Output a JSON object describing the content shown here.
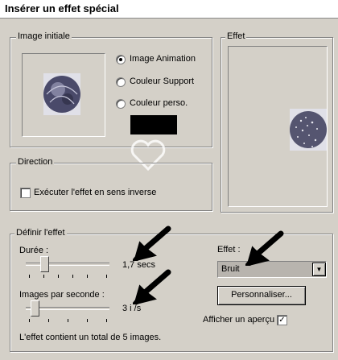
{
  "window": {
    "title": "Insérer un effet spécial"
  },
  "image_initiale": {
    "legend": "Image initiale",
    "options": [
      "Image Animation",
      "Couleur Support",
      "Couleur perso."
    ],
    "selected_index": 0,
    "color_swatch": "#000000"
  },
  "effet_preview": {
    "legend": "Effet"
  },
  "direction": {
    "legend": "Direction",
    "checkbox_label": "Exécuter l'effet en sens inverse",
    "checked": false
  },
  "definir": {
    "legend": "Définir l'effet",
    "duree_label": "Durée :",
    "duree_value": "1,7 secs",
    "duree_fraction": 0.2,
    "images_label": "Images par seconde :",
    "images_value": "3 i /s",
    "images_fraction": 0.08,
    "total_text": "L'effet contient un total de 5 images.",
    "effet_label": "Effet :",
    "effet_selected": "Bruit",
    "personnaliser_label": "Personnaliser...",
    "apercu_label": "Afficher un aperçu",
    "apercu_checked": true
  },
  "colors": {
    "dialog": "#d4d0c8",
    "select_bg": "#b8b4ae",
    "arrow": "#000000"
  },
  "icons": [
    "dropdown-arrow-icon",
    "check-icon",
    "heart-watermark-icon",
    "pointer-arrow-icon"
  ]
}
